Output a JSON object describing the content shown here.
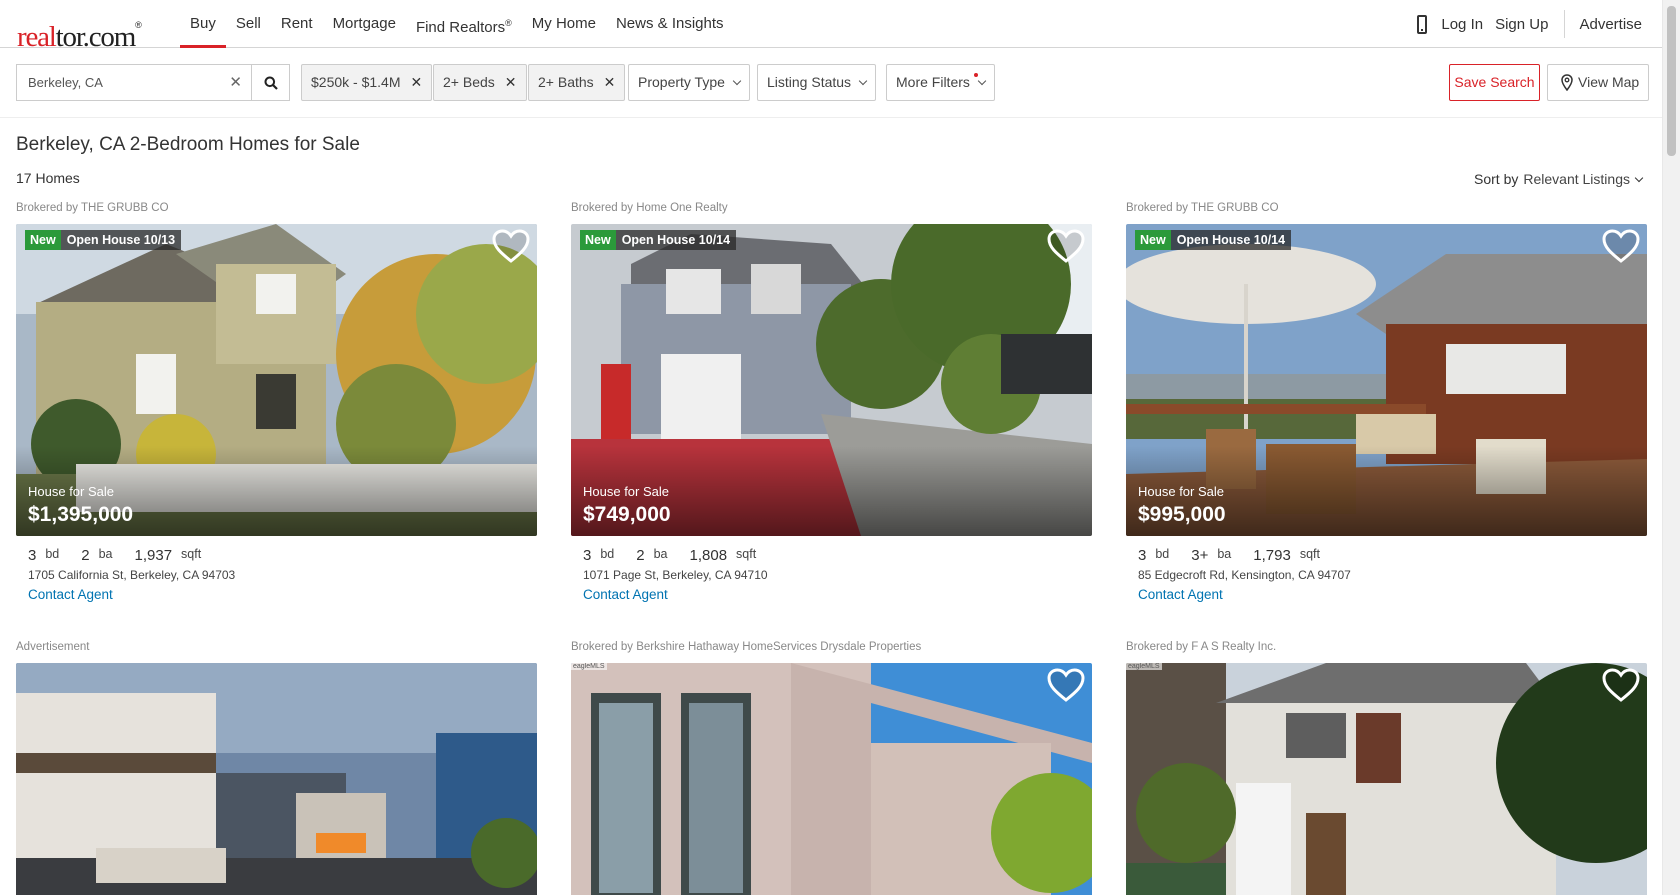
{
  "header": {
    "logo": {
      "part1": "real",
      "part2": "tor.com",
      "mark": "®"
    },
    "nav": [
      {
        "label": "Buy",
        "active": true
      },
      {
        "label": "Sell"
      },
      {
        "label": "Rent"
      },
      {
        "label": "Mortgage"
      },
      {
        "label": "Find Realtors",
        "sup": "®"
      },
      {
        "label": "My Home"
      },
      {
        "label": "News & Insights"
      }
    ],
    "login": "Log In",
    "signup": "Sign Up",
    "advertise": "Advertise"
  },
  "filters": {
    "search_value": "Berkeley, CA",
    "price": "$250k - $1.4M",
    "beds": "2+ Beds",
    "baths": "2+ Baths",
    "property_type": "Property Type",
    "listing_status": "Listing Status",
    "more_filters": "More Filters",
    "save_search": "Save Search",
    "view_map": "View Map"
  },
  "results": {
    "title": "Berkeley, CA 2-Bedroom Homes for Sale",
    "count": "17 Homes",
    "sort_label": "Sort by",
    "sort_value": "Relevant Listings"
  },
  "listings": [
    {
      "broker": "Brokered by THE GRUBB CO",
      "badge_new": "New",
      "open_house": "Open House 10/13",
      "type": "House for Sale",
      "price": "$1,395,000",
      "beds": "3",
      "beds_unit": "bd",
      "baths": "2",
      "baths_unit": "ba",
      "sqft": "1,937",
      "sqft_unit": "sqft",
      "address": "1705 California St, Berkeley, CA 94703",
      "contact": "Contact Agent"
    },
    {
      "broker": "Brokered by Home One Realty",
      "badge_new": "New",
      "open_house": "Open House 10/14",
      "type": "House for Sale",
      "price": "$749,000",
      "beds": "3",
      "beds_unit": "bd",
      "baths": "2",
      "baths_unit": "ba",
      "sqft": "1,808",
      "sqft_unit": "sqft",
      "address": "1071 Page St, Berkeley, CA 94710",
      "contact": "Contact Agent"
    },
    {
      "broker": "Brokered by THE GRUBB CO",
      "badge_new": "New",
      "open_house": "Open House 10/14",
      "type": "House for Sale",
      "price": "$995,000",
      "beds": "3",
      "beds_unit": "bd",
      "baths": "3+",
      "baths_unit": "ba",
      "sqft": "1,793",
      "sqft_unit": "sqft",
      "address": "85 Edgecroft Rd, Kensington, CA 94707",
      "contact": "Contact Agent"
    }
  ],
  "row2": [
    {
      "label": "Advertisement"
    },
    {
      "label": "Brokered by Berkshire Hathaway HomeServices Drysdale Properties",
      "mls": "eagleMLS"
    },
    {
      "label": "Brokered by F A S Realty Inc.",
      "mls": "eagleMLS"
    }
  ],
  "colors": {
    "brand_red": "#d92228",
    "link_blue": "#0073b1",
    "new_green": "#2b9a3a"
  }
}
